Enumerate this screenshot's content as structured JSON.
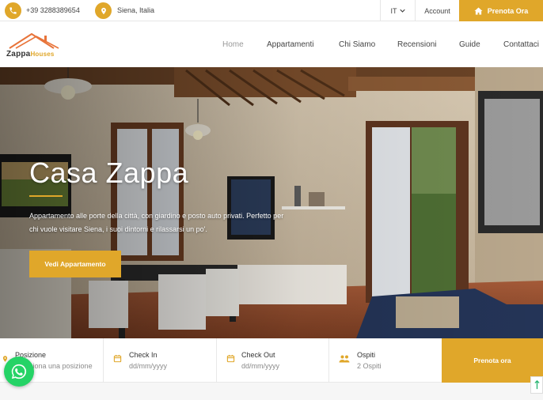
{
  "topbar": {
    "phone": "+39 3288389654",
    "location": "Siena, Italia",
    "language": "IT",
    "account": "Account",
    "book_now": "Prenota Ora"
  },
  "logo": {
    "brand_part1": "Zappa",
    "brand_part2": "Houses"
  },
  "nav": {
    "items": [
      "Home",
      "Appartamenti",
      "Chi Siamo",
      "Recensioni",
      "Guide",
      "Contattaci"
    ],
    "active": "Home"
  },
  "hero": {
    "title": "Casa Zappa",
    "description": "Appartamento alle porte della città, con giardino e posto auto privati. Perfetto per chi vuole visitare Siena, i suoi dintorni e rilassarsi un po'.",
    "button": "Vedi Appartamento"
  },
  "booking": {
    "position_label": "Posizione",
    "position_placeholder": "Seleziona una posizione",
    "checkin_label": "Check In",
    "checkin_placeholder": "dd/mm/yyyy",
    "checkout_label": "Check Out",
    "checkout_placeholder": "dd/mm/yyyy",
    "guests_label": "Ospiti",
    "guests_value": "2 Ospiti",
    "submit": "Prenota ora"
  },
  "colors": {
    "accent": "#e0a72a",
    "whatsapp": "#25d366"
  }
}
